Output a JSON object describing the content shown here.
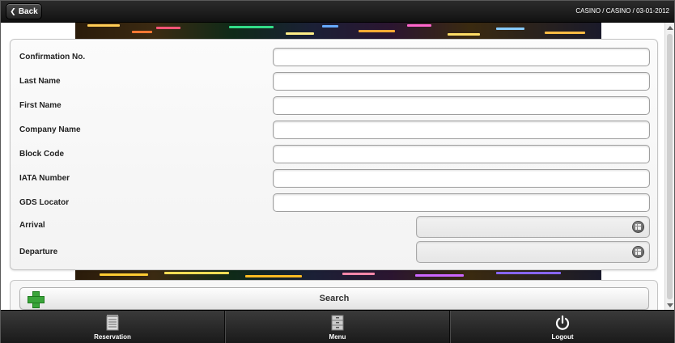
{
  "header": {
    "back_label": "Back",
    "info": "CASINO / CASINO / 03-01-2012"
  },
  "form": {
    "fields": [
      {
        "label": "Confirmation No.",
        "value": "",
        "type": "text"
      },
      {
        "label": "Last Name",
        "value": "",
        "type": "text"
      },
      {
        "label": "First Name",
        "value": "",
        "type": "text"
      },
      {
        "label": "Company Name",
        "value": "",
        "type": "text"
      },
      {
        "label": "Block Code",
        "value": "",
        "type": "text"
      },
      {
        "label": "IATA Number",
        "value": "",
        "type": "text"
      },
      {
        "label": "GDS Locator",
        "value": "",
        "type": "text"
      },
      {
        "label": "Arrival",
        "value": "",
        "type": "date"
      },
      {
        "label": "Departure",
        "value": "",
        "type": "date"
      }
    ]
  },
  "search": {
    "label": "Search",
    "icon": "plus-icon"
  },
  "nav": {
    "items": [
      {
        "label": "Reservation",
        "icon": "notepad-icon"
      },
      {
        "label": "Menu",
        "icon": "cabinet-icon"
      },
      {
        "label": "Logout",
        "icon": "power-icon"
      }
    ]
  },
  "colors": {
    "header_bg": "#1a1a1a",
    "accent_green": "#3aa53a",
    "panel_bg": "#f7f7f7"
  }
}
